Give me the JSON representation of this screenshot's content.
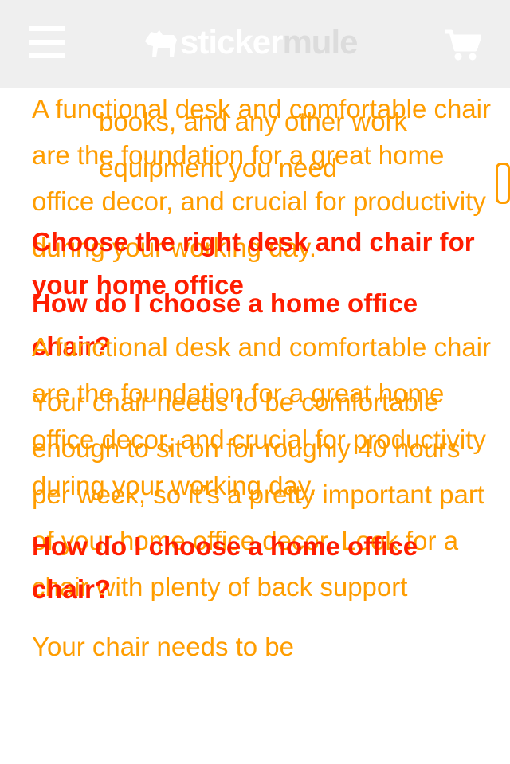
{
  "header": {
    "menu_icon": "hamburger-menu-icon",
    "logo_icon": "mule-silhouette-icon",
    "logo_text_part1": "sticker",
    "logo_text_part2": "mule",
    "cart_icon": "shopping-cart-icon",
    "background_color": "#efefef"
  },
  "colors": {
    "body_text": "#ff9d00",
    "heading_text": "#ff1e00"
  },
  "content_layer_a": {
    "fragment_line1": "books, and any other work",
    "fragment_line2": "equipment you need",
    "paragraph1": "A functional desk and comfortable chair are the foundation for a great home office decor, and crucial for productivity during your working day.",
    "heading1": "How do I choose a home office chair?",
    "paragraph2": "Your chair needs to be comfortable enough to sit on for roughly 40 hours per week, so it’s a pretty important part of your home office decor. Look for a chair with plenty of back support"
  },
  "content_layer_b": {
    "heading1": "Choose the right desk and chair for your home office",
    "paragraph1": "A functional desk and comfortable chair are the foundation for a great home office decor, and crucial for productivity during your working day.",
    "heading2": "How do I choose a home office chair?",
    "paragraph2": "Your chair needs to be"
  }
}
